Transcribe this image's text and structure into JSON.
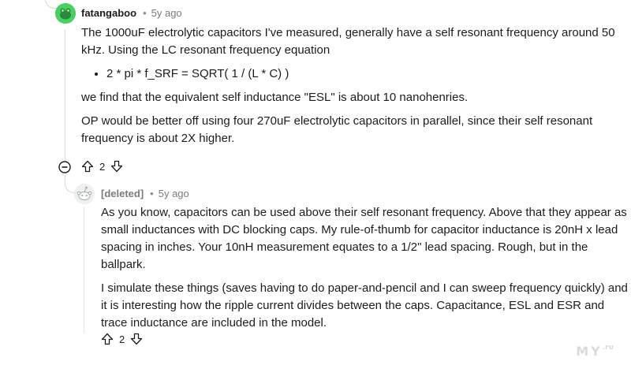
{
  "comment": {
    "author": "fatangaboo",
    "separator": "•",
    "time": "5y ago",
    "paragraph_1": "The 1000uF electrolytic capacitors I've measured, generally have a self resonant frequency around 50 kHz. Using the LC resonant frequency equation",
    "bullet": "2 * pi * f_SRF = SQRT( 1 / (L * C) )",
    "paragraph_2": "we find that the equivalent self inductance \"ESL\" is about 10 nanohenries.",
    "paragraph_3": "OP would be better off using four 270uF electrolytic capacitors in parallel, since their self resonant frequency is about 2X higher.",
    "score": "2",
    "avatar_icon": "snoo-avatar-icon"
  },
  "reply": {
    "author": "[deleted]",
    "separator": "•",
    "time": "5y ago",
    "paragraph_1": "As you know, capacitors can be used above their self resonant frequency. Above that they appear as small inductances with DC blocking caps. My rule-of-thumb for capacitor inductance is 20nH x lead spacing in inches. Your 10nH measurement equates to a 1/2\" lead spacing. Rough, but in the ballpark.",
    "paragraph_2": "I simulate these things (saves having to do paper-and-pencil and I can sweep frequency quickly) and it is interesting how the ripple current divides between the caps. Capacitance, ESL and ESR and trace inductance are included in the model.",
    "score": "2",
    "avatar_icon": "deleted-user-avatar-icon"
  },
  "watermark": {
    "text": "MY",
    "suffix": ".ru"
  },
  "colors": {
    "avatar_green": "#46d160",
    "thread_line": "#d6d8da",
    "meta_text": "#787c7e"
  }
}
